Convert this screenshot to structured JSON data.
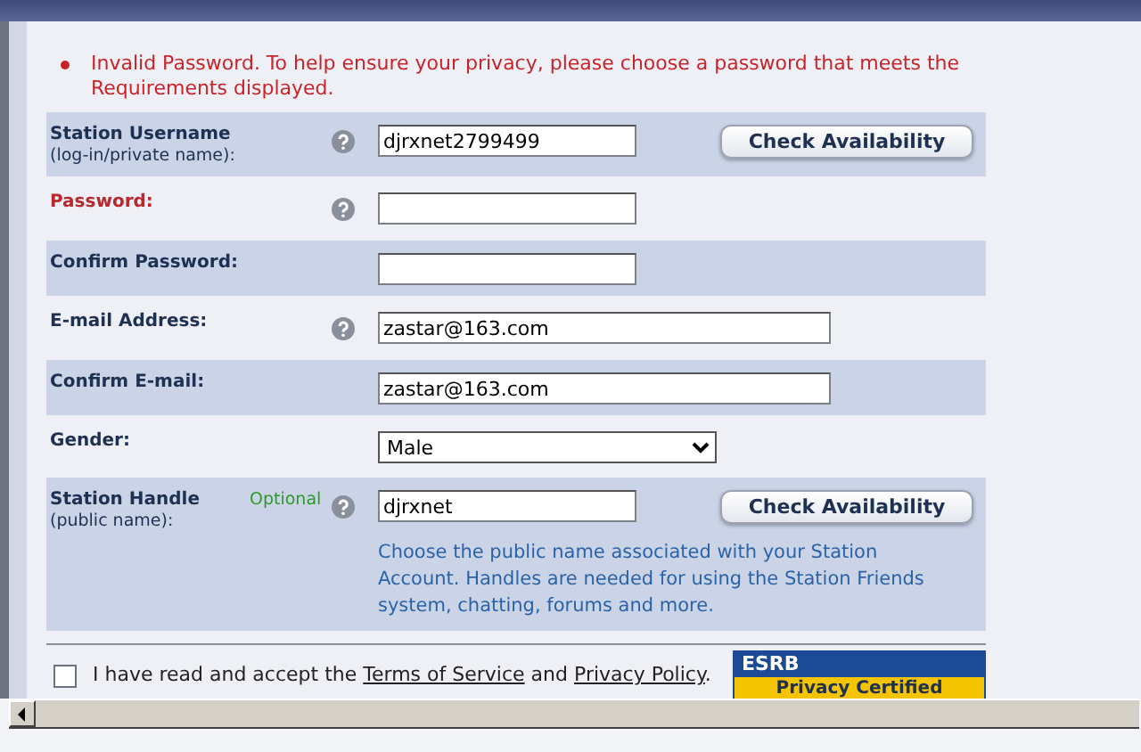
{
  "error": {
    "message": "Invalid Password. To help ensure your privacy, please choose a password that meets the Requirements displayed."
  },
  "rows": [
    {
      "kind": "short",
      "label": "Station Username",
      "sublabel": "(log-in/private name):",
      "invalid": false,
      "help": true,
      "value": "djrxnet2799499",
      "button": "Check Availability"
    },
    {
      "kind": "short",
      "label": "Password:",
      "invalid": true,
      "help": true,
      "value": ""
    },
    {
      "kind": "short",
      "label": "Confirm Password:",
      "invalid": false,
      "help": false,
      "value": ""
    },
    {
      "kind": "long",
      "label": "E-mail Address:",
      "invalid": false,
      "help": true,
      "value": "zastar@163.com"
    },
    {
      "kind": "long",
      "label": "Confirm E-mail:",
      "invalid": false,
      "help": false,
      "value": "zastar@163.com"
    },
    {
      "kind": "select",
      "label": "Gender:",
      "invalid": false,
      "help": false,
      "value": "Male"
    },
    {
      "kind": "short",
      "label": "Station Handle",
      "sublabel": "(public name):",
      "optional": "Optional",
      "invalid": false,
      "help": true,
      "value": "djrxnet",
      "button": "Check Availability",
      "hint": "Choose the public name associated with your Station Account. Handles are needed for using the Station Friends system, chatting, forums and more."
    }
  ],
  "agreement": {
    "checked": false,
    "before": "I have read and accept the",
    "terms_link": "Terms of Service",
    "and": "and",
    "privacy_link": "Privacy Policy",
    "after": "."
  },
  "seal": {
    "brand": "ESRB",
    "caption": "Privacy Certified"
  }
}
